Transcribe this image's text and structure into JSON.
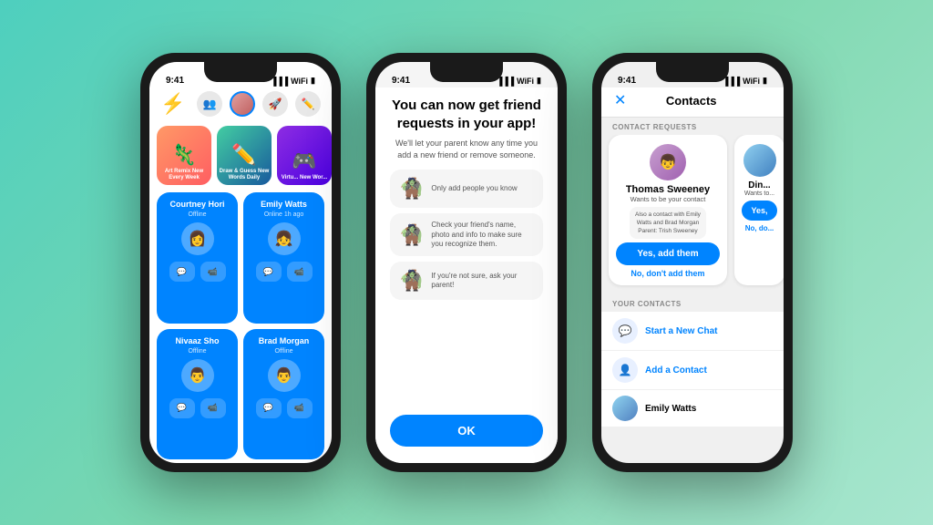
{
  "background": {
    "gradient": "teal-to-green"
  },
  "phone1": {
    "statusBar": {
      "time": "9:41"
    },
    "games": [
      {
        "label": "Art Remix\nNew Every Week",
        "icon": "🦎",
        "class": "game1"
      },
      {
        "label": "Draw & Guess\nNew Words Daily",
        "icon": "✏️",
        "class": "game2"
      },
      {
        "label": "Virtu...\nNew Wor...",
        "icon": "🎮",
        "class": "game3"
      }
    ],
    "contacts": [
      {
        "name": "Courtney Hori",
        "status": "Offline"
      },
      {
        "name": "Emily Watts",
        "status": "Online 1h ago"
      },
      {
        "name": "Nivaaz Sho",
        "status": "Offline"
      },
      {
        "name": "Brad Morgan",
        "status": "Offline"
      }
    ]
  },
  "phone2": {
    "statusBar": {
      "time": "9:41"
    },
    "title": "You can now get friend requests in your app!",
    "subtitle": "We'll let your parent know any time you add a new friend or remove someone.",
    "infoItems": [
      {
        "icon": "🧌",
        "text": "Only add people you know"
      },
      {
        "icon": "🧌",
        "text": "Check your friend's name, photo and info to make sure you recognize them."
      },
      {
        "icon": "🧌",
        "text": "If you're not sure, ask your parent!"
      }
    ],
    "okButton": "OK"
  },
  "phone3": {
    "statusBar": {
      "time": "9:41"
    },
    "title": "Contacts",
    "closeIcon": "✕",
    "sectionLabels": {
      "requests": "CONTACT REQUESTS",
      "yourContacts": "YOUR CONTACTS"
    },
    "contactRequests": [
      {
        "name": "Thomas Sweeney",
        "subtitle": "Wants to be your contact",
        "infoLine1": "Also a contact with Emily",
        "infoLine2": "Watts and Brad Morgan",
        "parentLine": "Parent: Trish Sweeney",
        "yesLabel": "Yes, add them",
        "noLabel": "No, don't add them"
      },
      {
        "name": "Din...",
        "subtitle": "Wants to...",
        "yesLabel": "Yes,",
        "noLabel": "No, do..."
      }
    ],
    "actions": [
      {
        "icon": "💬",
        "label": "Start a New Chat"
      },
      {
        "icon": "👤",
        "label": "Add a Contact"
      }
    ],
    "contactList": [
      {
        "name": "Emily Watts"
      }
    ]
  }
}
